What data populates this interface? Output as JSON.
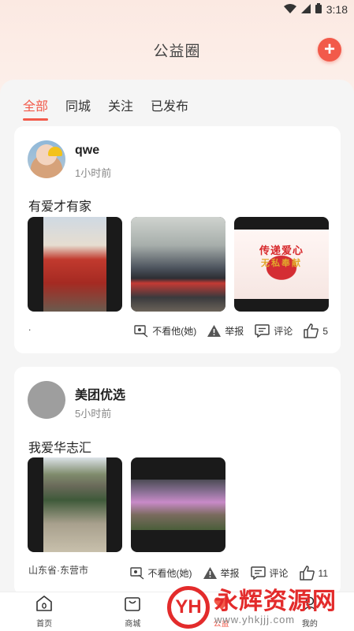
{
  "status_bar": {
    "time": "3:18",
    "icons": [
      "wifi-icon",
      "signal-icon",
      "battery-icon"
    ]
  },
  "header": {
    "title": "公益圈",
    "add_icon": "plus-icon"
  },
  "tabs": [
    {
      "label": "全部",
      "active": true
    },
    {
      "label": "同城",
      "active": false
    },
    {
      "label": "关注",
      "active": false
    },
    {
      "label": "已发布",
      "active": false
    }
  ],
  "posts": [
    {
      "user": "qwe",
      "time": "1小时前",
      "text": "有爱才有家",
      "images": 3,
      "image_text": {
        "line1": "传递爱心",
        "line2": "无私奉献"
      },
      "location": ".",
      "actions": {
        "hide": "不看他(她)",
        "report": "举报",
        "comment": "评论",
        "likes": "5"
      }
    },
    {
      "user": "美团优选",
      "time": "5小时前",
      "text": "我爱华志汇",
      "images": 2,
      "location": "山东省·东营市",
      "actions": {
        "hide": "不看他(她)",
        "report": "举报",
        "comment": "评论",
        "likes": "11"
      }
    }
  ],
  "bottom_nav": [
    {
      "label": "首页",
      "icon": "home-icon",
      "active": false
    },
    {
      "label": "商城",
      "icon": "bag-icon",
      "active": false
    },
    {
      "label": "公益",
      "icon": "heart-icon",
      "active": true
    },
    {
      "label": "我的",
      "icon": "user-icon",
      "active": false
    }
  ],
  "watermark": {
    "logo": "YH",
    "title": "永辉资源网",
    "url": "www.yhkjjj.com"
  },
  "colors": {
    "accent": "#f25a4a",
    "watermark": "#e32b2b"
  }
}
